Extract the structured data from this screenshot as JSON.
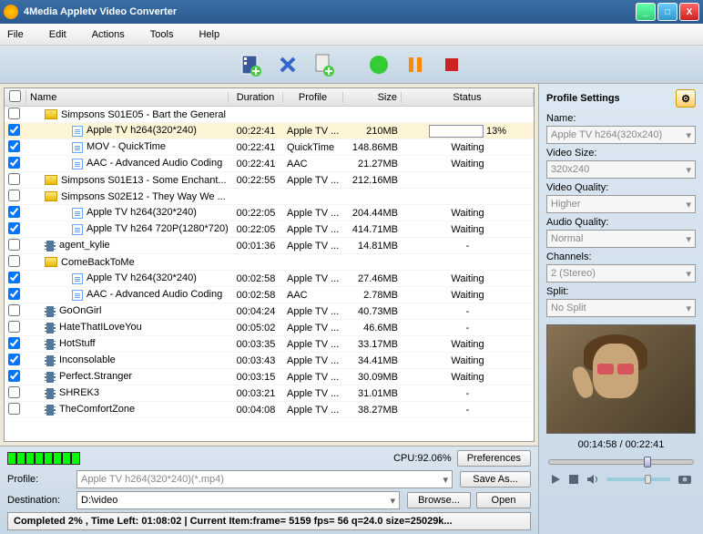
{
  "window": {
    "title": "4Media Appletv Video Converter"
  },
  "menu": [
    "File",
    "Edit",
    "Actions",
    "Tools",
    "Help"
  ],
  "columns": {
    "chk": "",
    "name": "Name",
    "duration": "Duration",
    "profile": "Profile",
    "size": "Size",
    "status": "Status"
  },
  "rows": [
    {
      "chk": false,
      "type": "folder",
      "indent": 1,
      "name": "Simpsons S01E05 - Bart the General",
      "dur": "",
      "prof": "",
      "size": "",
      "stat": ""
    },
    {
      "chk": true,
      "type": "doc",
      "indent": 2,
      "name": "Apple TV h264(320*240)",
      "dur": "00:22:41",
      "prof": "Apple TV ...",
      "size": "210MB",
      "stat": "13%",
      "sel": true,
      "prog": 13
    },
    {
      "chk": true,
      "type": "doc",
      "indent": 2,
      "name": "MOV - QuickTime",
      "dur": "00:22:41",
      "prof": "QuickTime",
      "size": "148.86MB",
      "stat": "Waiting"
    },
    {
      "chk": true,
      "type": "doc",
      "indent": 2,
      "name": "AAC - Advanced Audio Coding",
      "dur": "00:22:41",
      "prof": "AAC",
      "size": "21.27MB",
      "stat": "Waiting"
    },
    {
      "chk": false,
      "type": "folder",
      "indent": 1,
      "name": "Simpsons S01E13 - Some Enchant...",
      "dur": "00:22:55",
      "prof": "Apple TV ...",
      "size": "212.16MB",
      "stat": ""
    },
    {
      "chk": false,
      "type": "folder",
      "indent": 1,
      "name": "Simpsons S02E12 - They Way We ...",
      "dur": "",
      "prof": "",
      "size": "",
      "stat": ""
    },
    {
      "chk": true,
      "type": "doc",
      "indent": 2,
      "name": "Apple TV h264(320*240)",
      "dur": "00:22:05",
      "prof": "Apple TV ...",
      "size": "204.44MB",
      "stat": "Waiting"
    },
    {
      "chk": true,
      "type": "doc",
      "indent": 2,
      "name": "Apple TV h264 720P(1280*720)",
      "dur": "00:22:05",
      "prof": "Apple TV ...",
      "size": "414.71MB",
      "stat": "Waiting"
    },
    {
      "chk": false,
      "type": "film",
      "indent": 1,
      "name": "agent_kylie",
      "dur": "00:01:36",
      "prof": "Apple TV ...",
      "size": "14.81MB",
      "stat": "-"
    },
    {
      "chk": false,
      "type": "folder",
      "indent": 1,
      "name": "ComeBackToMe",
      "dur": "",
      "prof": "",
      "size": "",
      "stat": ""
    },
    {
      "chk": true,
      "type": "doc",
      "indent": 2,
      "name": "Apple TV h264(320*240)",
      "dur": "00:02:58",
      "prof": "Apple TV ...",
      "size": "27.46MB",
      "stat": "Waiting"
    },
    {
      "chk": true,
      "type": "doc",
      "indent": 2,
      "name": "AAC - Advanced Audio Coding",
      "dur": "00:02:58",
      "prof": "AAC",
      "size": "2.78MB",
      "stat": "Waiting"
    },
    {
      "chk": false,
      "type": "film",
      "indent": 1,
      "name": "GoOnGirl",
      "dur": "00:04:24",
      "prof": "Apple TV ...",
      "size": "40.73MB",
      "stat": "-"
    },
    {
      "chk": false,
      "type": "film",
      "indent": 1,
      "name": "HateThatILoveYou",
      "dur": "00:05:02",
      "prof": "Apple TV ...",
      "size": "46.6MB",
      "stat": "-"
    },
    {
      "chk": true,
      "type": "film",
      "indent": 1,
      "name": "HotStuff",
      "dur": "00:03:35",
      "prof": "Apple TV ...",
      "size": "33.17MB",
      "stat": "Waiting"
    },
    {
      "chk": true,
      "type": "film",
      "indent": 1,
      "name": "Inconsolable",
      "dur": "00:03:43",
      "prof": "Apple TV ...",
      "size": "34.41MB",
      "stat": "Waiting"
    },
    {
      "chk": true,
      "type": "film",
      "indent": 1,
      "name": "Perfect.Stranger",
      "dur": "00:03:15",
      "prof": "Apple TV ...",
      "size": "30.09MB",
      "stat": "Waiting"
    },
    {
      "chk": false,
      "type": "film",
      "indent": 1,
      "name": "SHREK3",
      "dur": "00:03:21",
      "prof": "Apple TV ...",
      "size": "31.01MB",
      "stat": "-"
    },
    {
      "chk": false,
      "type": "film",
      "indent": 1,
      "name": "TheComfortZone",
      "dur": "00:04:08",
      "prof": "Apple TV ...",
      "size": "38.27MB",
      "stat": "-"
    }
  ],
  "cpu": {
    "label": "CPU:92.06%",
    "prefs": "Preferences"
  },
  "profile": {
    "label": "Profile:",
    "value": "Apple TV h264(320*240)(*.mp4)",
    "saveAs": "Save As..."
  },
  "dest": {
    "label": "Destination:",
    "value": "D:\\video",
    "browse": "Browse...",
    "open": "Open"
  },
  "status": "Completed 2% , Time Left: 01:08:02 | Current Item:frame= 5159 fps= 56 q=24.0 size=25029k...",
  "settings": {
    "title": "Profile Settings",
    "fields": {
      "name": {
        "label": "Name:",
        "value": "Apple TV h264(320x240)"
      },
      "videoSize": {
        "label": "Video Size:",
        "value": "320x240"
      },
      "videoQuality": {
        "label": "Video Quality:",
        "value": "Higher"
      },
      "audioQuality": {
        "label": "Audio Quality:",
        "value": "Normal"
      },
      "channels": {
        "label": "Channels:",
        "value": "2 (Stereo)"
      },
      "split": {
        "label": "Split:",
        "value": "No Split"
      }
    }
  },
  "player": {
    "time": "00:14:58 / 00:22:41",
    "pos": 66
  }
}
